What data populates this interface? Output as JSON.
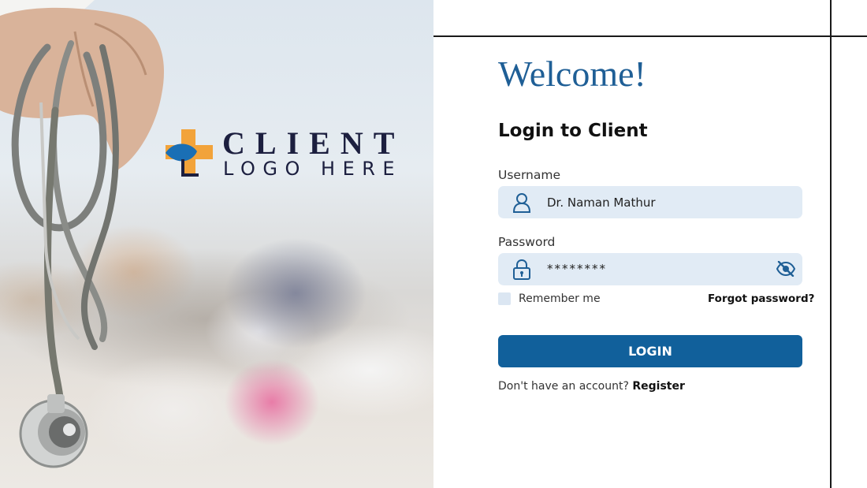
{
  "hero": {
    "logo_line1": "CLIENT",
    "logo_line2": "LOGO HERE",
    "icons": {
      "logo": "medical-cross-leaf-logo",
      "image": "stethoscope-photo"
    }
  },
  "login": {
    "welcome": "Welcome!",
    "title": "Login to Client",
    "username_label": "Username",
    "username_value": "Dr. Naman Mathur",
    "password_label": "Password",
    "password_value": "********",
    "remember_label": "Remember me",
    "remember_checked": false,
    "forgot_label": "Forgot password?",
    "login_button": "LOGIN",
    "register_prompt": "Don't have an account?",
    "register_link": "Register"
  },
  "icons": {
    "username": "user-icon",
    "password": "lock-icon",
    "toggle": "eye-off-icon"
  },
  "colors": {
    "accent": "#1f5f96",
    "button": "#11609b",
    "field_bg": "#e1ebf5",
    "logo_orange": "#f2a33a",
    "logo_blue": "#1a6fb5",
    "logo_text": "#1c1f3f"
  }
}
